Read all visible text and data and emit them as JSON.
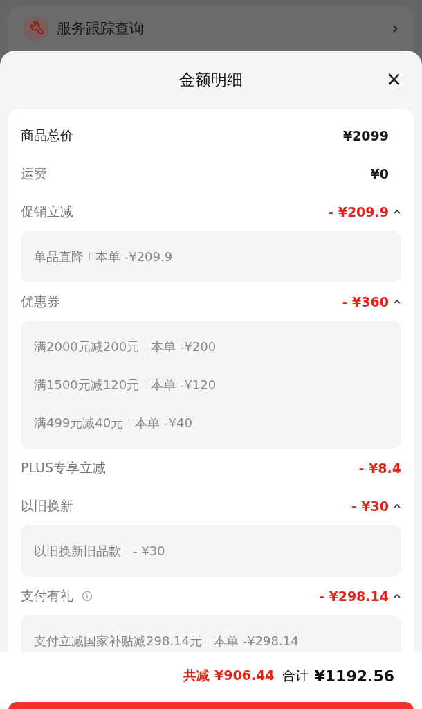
{
  "background_row": {
    "label": "服务跟踪查询",
    "chevron": "›"
  },
  "sheet": {
    "title": "金额明细",
    "close": "×"
  },
  "items": [
    {
      "label": "商品总价",
      "amount": "¥2099",
      "kind": "total"
    },
    {
      "label": "运费",
      "amount": "¥0",
      "kind": "price"
    },
    {
      "label": "促销立减",
      "amount": "- ¥209.9",
      "kind": "discount",
      "expanded": true,
      "details": [
        {
          "name": "单品直降",
          "amount": "本单 -¥209.9"
        }
      ]
    },
    {
      "label": "优惠券",
      "amount": "- ¥360",
      "kind": "discount",
      "expanded": true,
      "details": [
        {
          "name": "满2000元减200元",
          "amount": "本单 -¥200"
        },
        {
          "name": "满1500元减120元",
          "amount": "本单 -¥120"
        },
        {
          "name": "满499元减40元",
          "amount": "本单 -¥40"
        }
      ]
    },
    {
      "label": "PLUS专享立减",
      "amount": "- ¥8.4",
      "kind": "discount"
    },
    {
      "label": "以旧换新",
      "amount": "- ¥30",
      "kind": "discount",
      "expanded": true,
      "details": [
        {
          "name": "以旧换新旧品款",
          "amount": "- ¥30"
        }
      ]
    },
    {
      "label": "支付有礼",
      "amount": "- ¥298.14",
      "kind": "discount",
      "info": true,
      "expanded": true,
      "details": [
        {
          "name": "支付立减国家补贴减298.14元",
          "amount": "本单 -¥298.14"
        }
      ]
    }
  ],
  "footer": {
    "saved": "共减 ¥906.44",
    "total_label": "合计",
    "total": "¥1192.56"
  }
}
